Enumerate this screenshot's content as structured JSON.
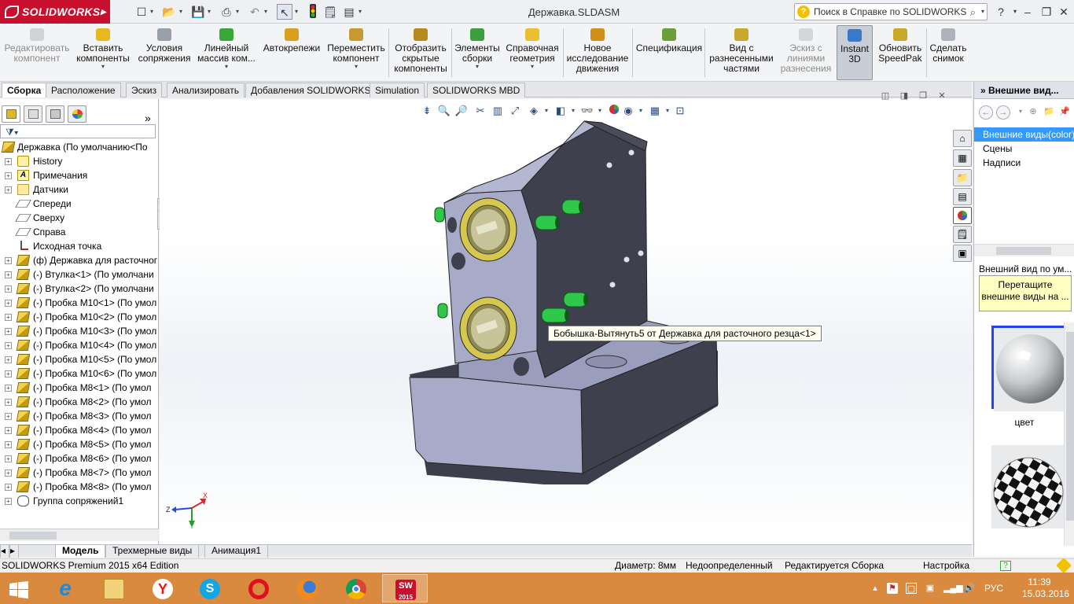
{
  "app": {
    "logo": "SOLIDWORKS",
    "doc_title": "Державка.SLDASM",
    "help_search_placeholder": "Поиск в Справке по SOLIDWORKS"
  },
  "command_manager": {
    "buttons": [
      {
        "label": "Редактировать компонент",
        "disabled": true
      },
      {
        "label": "Вставить компоненты"
      },
      {
        "label": "Условия сопряжения"
      },
      {
        "label": "Линейный массив ком..."
      },
      {
        "label": "Автокрепежи"
      },
      {
        "label": "Переместить компонент"
      },
      {
        "label": "Отобразить скрытые компоненты"
      },
      {
        "label": "Элементы сборки"
      },
      {
        "label": "Справочная геометрия"
      },
      {
        "label": "Новое исследование движения"
      },
      {
        "label": "Спецификация"
      },
      {
        "label": "Вид с разнесенными частями"
      },
      {
        "label": "Эскиз с линиями разнесения",
        "disabled": true
      },
      {
        "label": "Instant 3D",
        "active": true
      },
      {
        "label": "Обновить SpeedPak"
      },
      {
        "label": "Сделать снимок"
      }
    ]
  },
  "command_tabs": [
    "Сборка",
    "Расположение",
    "Эскиз",
    "Анализировать",
    "Добавления SOLIDWORKS",
    "Simulation",
    "SOLIDWORKS MBD"
  ],
  "feature_tree": {
    "root": "Державка  (По умолчанию<По",
    "items": [
      {
        "label": "History",
        "icon": "history-icon"
      },
      {
        "label": "Примечания",
        "icon": "annotations-icon"
      },
      {
        "label": "Датчики",
        "icon": "sensors-icon"
      },
      {
        "label": "Спереди",
        "icon": "plane-icon"
      },
      {
        "label": "Сверху",
        "icon": "plane-icon"
      },
      {
        "label": "Справа",
        "icon": "plane-icon"
      },
      {
        "label": "Исходная точка",
        "icon": "origin-icon"
      },
      {
        "label": "(ф) Державка для расточног",
        "icon": "part-icon"
      },
      {
        "label": "(-) Втулка<1> (По умолчани",
        "icon": "part-icon"
      },
      {
        "label": "(-) Втулка<2> (По умолчани",
        "icon": "part-icon"
      },
      {
        "label": "(-) Пробка М10<1> (По умол",
        "icon": "part-icon"
      },
      {
        "label": "(-) Пробка М10<2> (По умол",
        "icon": "part-icon"
      },
      {
        "label": "(-) Пробка М10<3> (По умол",
        "icon": "part-icon"
      },
      {
        "label": "(-) Пробка М10<4> (По умол",
        "icon": "part-icon"
      },
      {
        "label": "(-) Пробка М10<5> (По умол",
        "icon": "part-icon"
      },
      {
        "label": "(-) Пробка М10<6> (По умол",
        "icon": "part-icon"
      },
      {
        "label": "(-) Пробка М8<1> (По умол",
        "icon": "part-icon"
      },
      {
        "label": "(-) Пробка М8<2> (По умол",
        "icon": "part-icon"
      },
      {
        "label": "(-) Пробка М8<3> (По умол",
        "icon": "part-icon"
      },
      {
        "label": "(-) Пробка М8<4> (По умол",
        "icon": "part-icon"
      },
      {
        "label": "(-) Пробка М8<5> (По умол",
        "icon": "part-icon"
      },
      {
        "label": "(-) Пробка М8<6> (По умол",
        "icon": "part-icon"
      },
      {
        "label": "(-) Пробка М8<7> (По умол",
        "icon": "part-icon"
      },
      {
        "label": "(-) Пробка М8<8> (По умол",
        "icon": "part-icon"
      },
      {
        "label": "Группа сопряжений1",
        "icon": "mates-icon"
      }
    ]
  },
  "graphics": {
    "tooltip": "Бобышка-Вытянуть5 от Державка для расточного резца<1>",
    "triad": {
      "x": "X",
      "y": "Y",
      "z": "Z"
    }
  },
  "task_pane": {
    "title": "Внешние вид...",
    "tree": [
      "Внешние виды(color)",
      "Сцены",
      "Надписи"
    ],
    "subheader": "Внешний вид по ум...",
    "hint": "Перетащите внешние виды на ...",
    "thumb_label": "цвет"
  },
  "bottom_tabs": [
    "Модель",
    "Трехмерные виды",
    "Анимация1"
  ],
  "status_bar": {
    "edition": "SOLIDWORKS Premium 2015 x64 Edition",
    "diameter": "Диаметр: 8мм",
    "state": "Недоопределенный",
    "editing": "Редактируется Сборка",
    "settings": "Настройка"
  },
  "taskbar": {
    "lang": "РУС",
    "time": "11:39",
    "date": "15.03.2016",
    "sw_badge": "2015"
  },
  "colors": {
    "logo_red": "#c8102e",
    "taskbar_orange": "#d98a3e",
    "selection_blue": "#3399ff",
    "model_face": "#a6a9c6",
    "model_dark": "#3c3e4c",
    "plug_green": "#2ec84a",
    "bushing_gold": "#d8c850"
  }
}
